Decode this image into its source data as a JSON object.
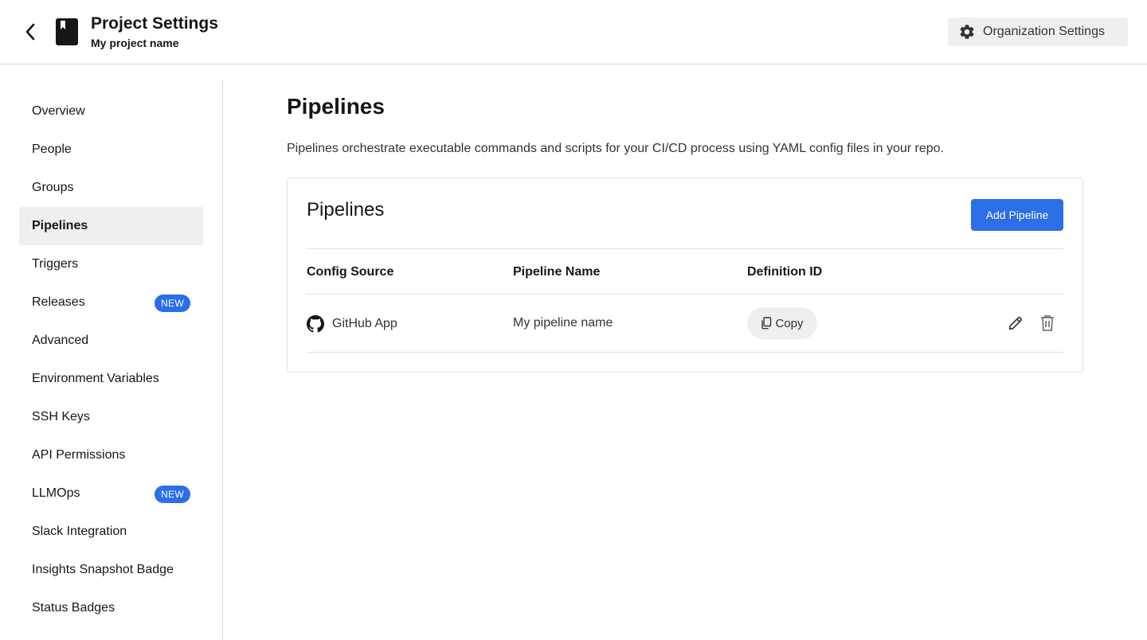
{
  "header": {
    "title": "Project Settings",
    "subtitle": "My project name",
    "org_settings_label": "Organization Settings"
  },
  "sidebar": {
    "items": [
      {
        "label": "Overview"
      },
      {
        "label": "People"
      },
      {
        "label": "Groups"
      },
      {
        "label": "Pipelines",
        "active": true
      },
      {
        "label": "Triggers"
      },
      {
        "label": "Releases",
        "badge": "NEW"
      },
      {
        "label": "Advanced"
      },
      {
        "label": "Environment Variables"
      },
      {
        "label": "SSH Keys"
      },
      {
        "label": "API Permissions"
      },
      {
        "label": "LLMOps",
        "badge": "NEW"
      },
      {
        "label": "Slack Integration"
      },
      {
        "label": "Insights Snapshot Badge"
      },
      {
        "label": "Status Badges"
      }
    ]
  },
  "main": {
    "title": "Pipelines",
    "description": "Pipelines orchestrate executable commands and scripts for your CI/CD process using YAML config files in your repo.",
    "card": {
      "title": "Pipelines",
      "add_button_label": "Add Pipeline",
      "columns": [
        "Config Source",
        "Pipeline Name",
        "Definition ID"
      ],
      "rows": [
        {
          "config_source": "GitHub App",
          "pipeline_name": "My pipeline name",
          "definition_action": "Copy"
        }
      ]
    }
  },
  "colors": {
    "accent": "#2b6ee8",
    "active_nav_bg": "#efefef",
    "border": "#e0e0e0"
  },
  "icons": {
    "back": "chevron-left-icon",
    "project": "project-book-icon",
    "org": "gear-icon",
    "source": "github-icon",
    "copy": "copy-icon",
    "edit": "pencil-icon",
    "delete": "trash-icon"
  }
}
